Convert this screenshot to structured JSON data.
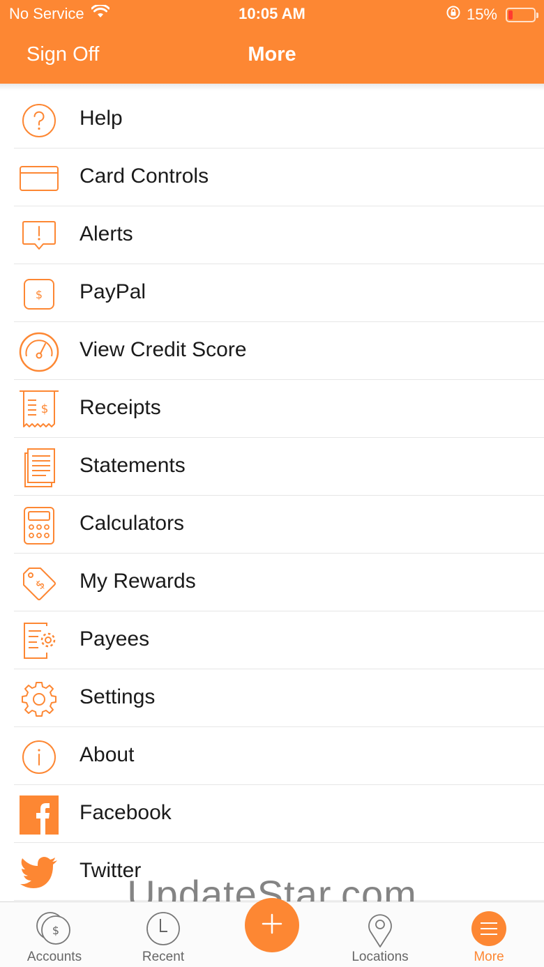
{
  "status_bar": {
    "carrier": "No Service",
    "time": "10:05 AM",
    "battery": "15%",
    "battery_level": 0.15,
    "icons": [
      "wifi-icon",
      "orientation-lock-icon",
      "battery-icon"
    ]
  },
  "nav": {
    "left_button": "Sign Off",
    "title": "More"
  },
  "menu": {
    "items": [
      {
        "label": "Help",
        "icon": "help-icon"
      },
      {
        "label": "Card Controls",
        "icon": "card-icon"
      },
      {
        "label": "Alerts",
        "icon": "alert-icon"
      },
      {
        "label": "PayPal",
        "icon": "paypal-icon"
      },
      {
        "label": "View Credit Score",
        "icon": "gauge-icon"
      },
      {
        "label": "Receipts",
        "icon": "receipt-icon"
      },
      {
        "label": "Statements",
        "icon": "statements-icon"
      },
      {
        "label": "Calculators",
        "icon": "calculator-icon"
      },
      {
        "label": "My Rewards",
        "icon": "rewards-tag-icon"
      },
      {
        "label": "Payees",
        "icon": "payees-icon"
      },
      {
        "label": "Settings",
        "icon": "gear-icon"
      },
      {
        "label": "About",
        "icon": "info-icon"
      },
      {
        "label": "Facebook",
        "icon": "facebook-icon"
      },
      {
        "label": "Twitter",
        "icon": "twitter-icon"
      }
    ]
  },
  "tabbar": {
    "accounts": "Accounts",
    "recent": "Recent",
    "locations": "Locations",
    "more": "More",
    "active": "More"
  },
  "watermark": "UpdateStar.com",
  "colors": {
    "accent": "#FD8733",
    "text": "#1a1a1a",
    "tab_inactive": "#666666"
  }
}
